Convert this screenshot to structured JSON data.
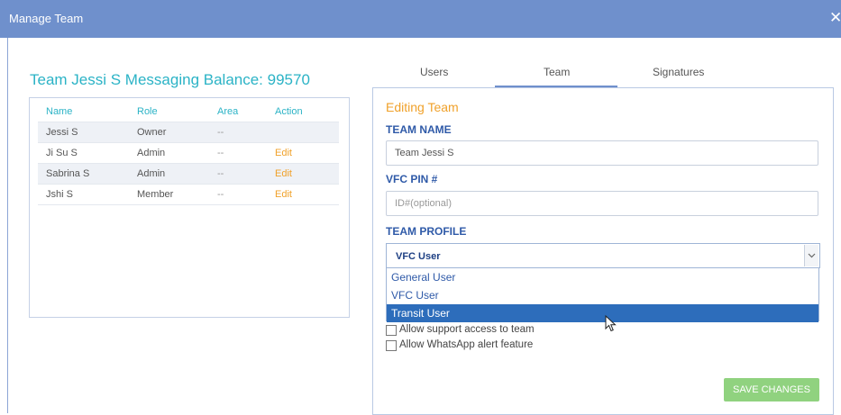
{
  "window": {
    "title": "Manage Team",
    "close_glyph": "✕"
  },
  "balance_text": "Team Jessi S Messaging Balance: 99570",
  "tabs": [
    {
      "label": "Users",
      "active": false
    },
    {
      "label": "Team",
      "active": true
    },
    {
      "label": "Signatures",
      "active": false
    }
  ],
  "table": {
    "headers": [
      "Name",
      "Role",
      "Area",
      "Action"
    ],
    "rows": [
      {
        "name": "Jessi S",
        "role": "Owner",
        "area": "--",
        "action": ""
      },
      {
        "name": "Ji Su S",
        "role": "Admin",
        "area": "--",
        "action": "Edit"
      },
      {
        "name": "Sabrina S",
        "role": "Admin",
        "area": "--",
        "action": "Edit"
      },
      {
        "name": "Jshi S",
        "role": "Member",
        "area": "--",
        "action": "Edit"
      }
    ]
  },
  "form": {
    "heading": "Editing Team",
    "team_name_label": "TEAM NAME",
    "team_name_value": "Team Jessi S",
    "pin_label": "VFC PIN #",
    "pin_placeholder": "ID#(optional)",
    "profile_label": "TEAM PROFILE",
    "profile_selected": "VFC User",
    "profile_options": [
      "General User",
      "VFC User",
      "Transit User"
    ],
    "highlighted_option": "Transit User",
    "checkboxes": [
      {
        "label": "Allow support access to team",
        "checked": false
      },
      {
        "label": "Allow WhatsApp alert feature",
        "checked": false
      }
    ],
    "save_label": "SAVE CHANGES"
  },
  "colors": {
    "titlebar": "#6f90cc",
    "accent_teal": "#2bb3c6",
    "accent_orange": "#f0a12a",
    "label_blue": "#2f5aa8",
    "highlight": "#2d6dbb",
    "save_green": "#90d27f"
  },
  "icons": {
    "close": "close-icon",
    "dropdown": "chevron-down-icon",
    "cursor": "mouse-pointer-icon"
  }
}
